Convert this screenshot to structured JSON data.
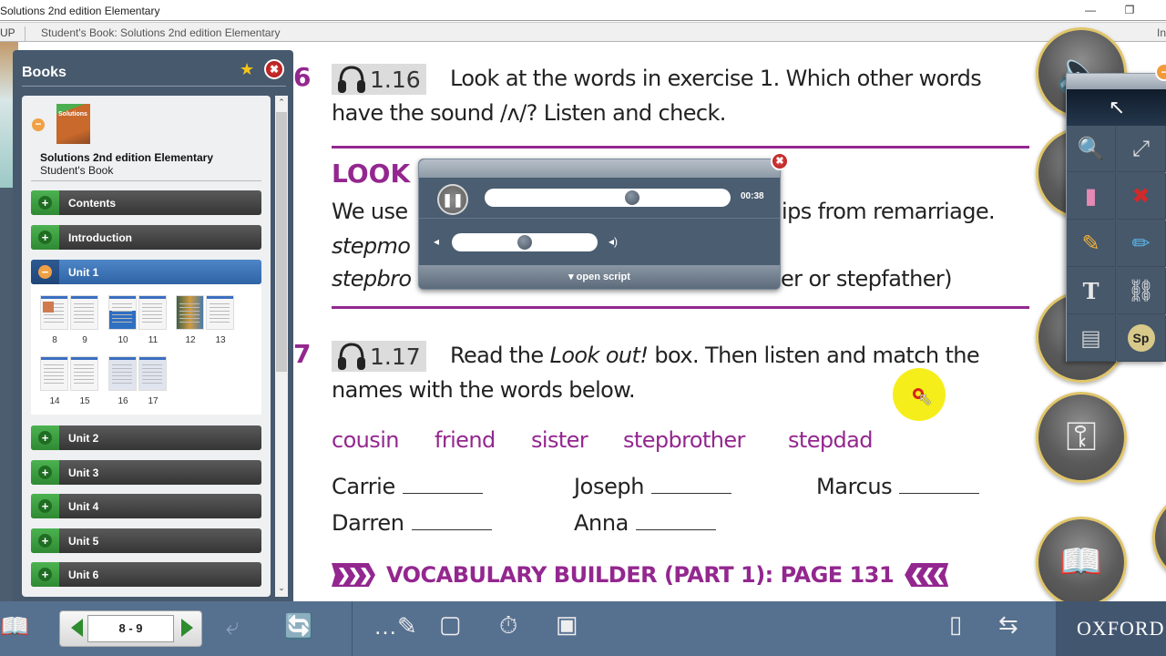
{
  "window": {
    "title": "Solutions 2nd edition Elementary",
    "minimize_icon": "minimize-icon",
    "restore_icon": "restore-icon"
  },
  "tabs": {
    "left_fragment": "UP",
    "active": "Student's Book: Solutions 2nd edition Elementary",
    "right_fragment": "In"
  },
  "books_panel": {
    "title": "Books",
    "book_title": "Solutions 2nd edition Elementary",
    "book_subtitle": "Student's Book",
    "cover_label": "Solutions",
    "sections": [
      {
        "label": "Contents",
        "state": "collapsed"
      },
      {
        "label": "Introduction",
        "state": "collapsed"
      },
      {
        "label": "Unit 1",
        "state": "expanded"
      },
      {
        "label": "Unit 2",
        "state": "collapsed"
      },
      {
        "label": "Unit 3",
        "state": "collapsed"
      },
      {
        "label": "Unit 4",
        "state": "collapsed"
      },
      {
        "label": "Unit 5",
        "state": "collapsed"
      },
      {
        "label": "Unit 6",
        "state": "collapsed"
      }
    ],
    "unit1_pages": [
      {
        "left": "8",
        "right": "9"
      },
      {
        "left": "10",
        "right": "11"
      },
      {
        "left": "12",
        "right": "13"
      },
      {
        "left": "14",
        "right": "15"
      },
      {
        "left": "16",
        "right": "17"
      }
    ]
  },
  "page": {
    "exercise6": {
      "number": "6",
      "track": "1.16",
      "line1": "Look at the words in exercise 1. Which other words",
      "line2": "have the sound /ʌ/? Listen and check."
    },
    "look_out": {
      "title": "LOOK",
      "line1_start": "We use",
      "line1_end": "ips from remarriage.",
      "line2_start": "stepmo",
      "line3_start": "stepbro",
      "line3_end": "er or stepfather)"
    },
    "exercise7": {
      "number": "7",
      "track": "1.17",
      "line1_a": "Read the ",
      "line1_italic": "Look out!",
      "line1_b": " box. Then listen and match the",
      "line2": "names with the words below."
    },
    "word_options": [
      "cousin",
      "friend",
      "sister",
      "stepbrother",
      "stepdad"
    ],
    "names": [
      "Carrie",
      "Joseph",
      "Marcus",
      "Darren",
      "Anna"
    ],
    "vocab_banner": "VOCABULARY BUILDER (PART 1): PAGE 131",
    "banner_chevrons_right": "❯❯❯",
    "banner_chevrons_left": "❮❮❮"
  },
  "audio_player": {
    "time": "00:38",
    "progress_fraction": 0.6,
    "volume_fraction": 0.5,
    "pause_glyph": "❚❚",
    "open_script_label": "▾ open script",
    "close_glyph": "✖",
    "vol_low_glyph": "◂",
    "vol_high_glyph": "◂)"
  },
  "tools_panel": {
    "items": [
      {
        "name": "zoom-in-icon",
        "glyph": "🔍"
      },
      {
        "name": "fullscreen-window-icon",
        "glyph": "⤢"
      },
      {
        "name": "eraser-icon",
        "glyph": "▮"
      },
      {
        "name": "close-window-icon",
        "glyph": "✖"
      },
      {
        "name": "pencil-icon",
        "glyph": "✎"
      },
      {
        "name": "highlighter-icon",
        "glyph": "✏"
      },
      {
        "name": "text-tool-icon",
        "glyph": "T"
      },
      {
        "name": "link-icon",
        "glyph": "⛓"
      },
      {
        "name": "card-icon",
        "glyph": "▤"
      },
      {
        "name": "spotlight-icon",
        "glyph": "Sp"
      }
    ],
    "select_glyph": "↖",
    "minimize_glyph": "−"
  },
  "round_buttons": {
    "key_glyph": "⚿",
    "book_glyph": "🕮"
  },
  "bottom_toolbar": {
    "page_field": "8 - 9",
    "brand": "OXFORD"
  },
  "colors": {
    "accent_purple": "#93278f",
    "panel_slate": "#47596d",
    "toolbar_blue": "#56708f",
    "unit_green": "#3ea043",
    "unit_selected_blue": "#3c74b8",
    "cursor_highlight": "#f6ee1a"
  }
}
